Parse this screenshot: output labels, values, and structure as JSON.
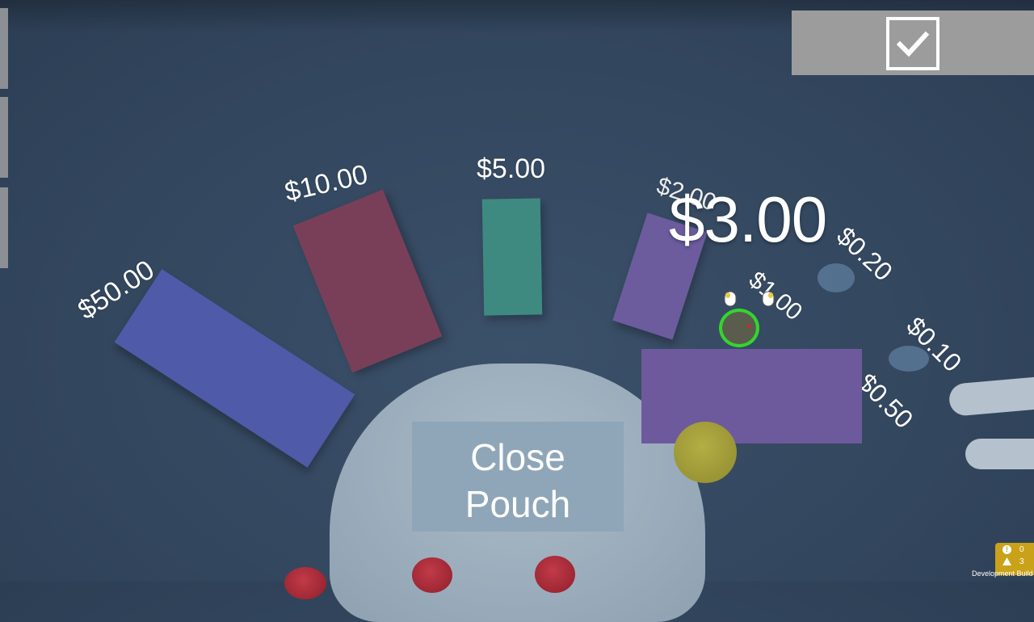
{
  "hud": {
    "confirm_icon": "checkmark-icon",
    "total": "$3.00",
    "close_button": {
      "line1": "Close",
      "line2": "Pouch"
    }
  },
  "denominations": {
    "d50": "$50.00",
    "d10": "$10.00",
    "d5": "$5.00",
    "d2": "$2.00",
    "d1": "$1.00",
    "d020": "$0.20",
    "d010": "$0.10",
    "d050": "$0.50"
  },
  "colors": {
    "bill_50": "#4f5aa8",
    "bill_10": "#7a3f58",
    "bill_5": "#3f8a80",
    "bill_2": "#6c5c9e",
    "selected_bill": "#6d5a9c",
    "coin_gold": "#a19c3a",
    "coin_silver": "#5a7898",
    "cursor_ring": "#33d62d"
  },
  "debug": {
    "errors": "0",
    "warnings": "3",
    "build_label": "Development Build"
  }
}
